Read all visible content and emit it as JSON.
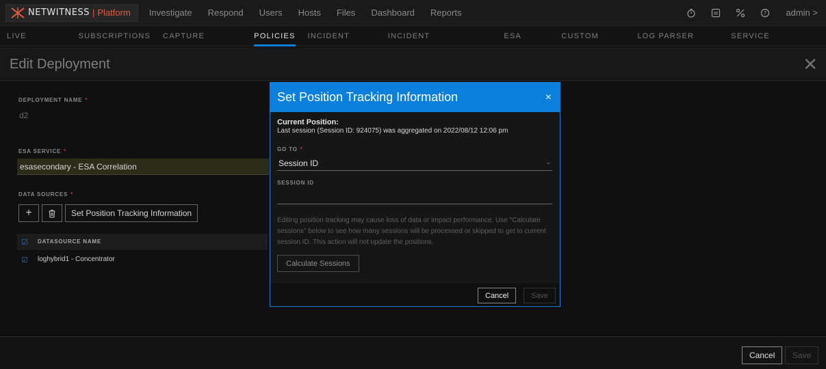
{
  "brand": {
    "name": "NETWITNESS",
    "separator": "|",
    "product": "Platform"
  },
  "main_nav": [
    "Investigate",
    "Respond",
    "Users",
    "Hosts",
    "Files",
    "Dashboard",
    "Reports"
  ],
  "top_icons": [
    "timer-icon",
    "notifications-icon",
    "tools-icon",
    "help-icon"
  ],
  "user": {
    "label": "admin >"
  },
  "sub_nav": {
    "items": [
      "LIVE CONTENT",
      "SUBSCRIPTIONS",
      "CAPTURE POLICIES",
      "POLICIES",
      "INCIDENT RULES",
      "INCIDENT NOTIFICATIONS",
      "ESA RULES",
      "CUSTOM FEEDS",
      "LOG PARSER RULES",
      "SERVICE TOPOLOGY"
    ],
    "active": "POLICIES"
  },
  "page": {
    "title": "Edit Deployment",
    "close_symbol": "✕"
  },
  "form": {
    "deployment_name_label": "DEPLOYMENT NAME",
    "deployment_name_value": "d2",
    "esa_service_label": "ESA SERVICE",
    "esa_service_value": "esasecondary - ESA Correlation",
    "data_sources_label": "DATA SOURCES",
    "set_position_button": "Set Position Tracking Information",
    "datasource_header": "DATASOURCE NAME",
    "datasources": [
      "loghybrid1 - Concentrator"
    ],
    "required_marker": "*"
  },
  "footer": {
    "cancel_label": "Cancel",
    "save_label": "Save"
  },
  "modal": {
    "title": "Set Position Tracking Information",
    "close_symbol": "×",
    "current_position_label": "Current Position:",
    "current_position_text": "Last session (Session ID: 924075) was aggregated on 2022/08/12 12:06 pm",
    "goto_label": "GO TO",
    "goto_value": "Session ID",
    "session_id_label": "SESSION ID",
    "session_id_value": "",
    "warning": "Editing position tracking may cause loss of data or impact performance. Use \"Calculate sessions\" below to see how many sessions will be processed or skipped to get to current session ID. This action will not update the positions.",
    "calculate_button": "Calculate Sessions",
    "cancel_label": "Cancel",
    "save_label": "Save"
  },
  "colors": {
    "accent": "#0b7fdc",
    "brand": "#e35c3e",
    "required": "#c0392b"
  }
}
